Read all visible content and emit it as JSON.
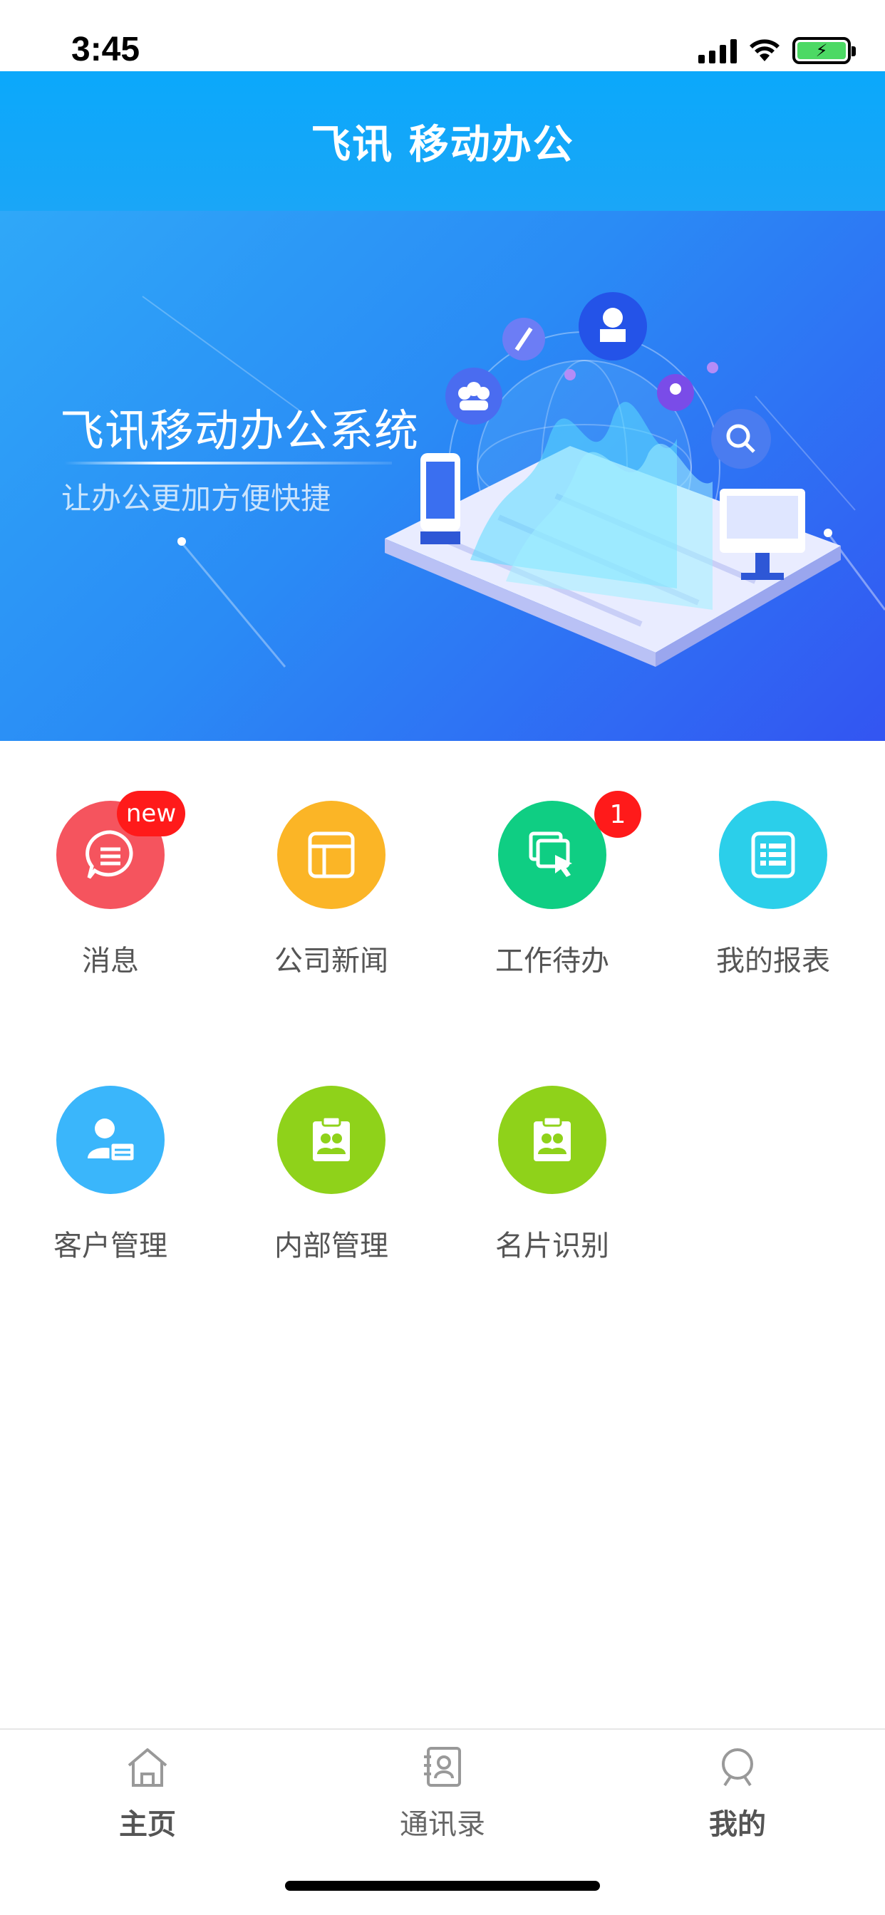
{
  "status_bar": {
    "time": "3:45",
    "battery_icon": "battery-charging-icon"
  },
  "header": {
    "title": "飞讯 移动办公"
  },
  "banner": {
    "title": "飞讯移动办公系统",
    "subtitle": "让办公更加方便快捷"
  },
  "grid": {
    "items": [
      {
        "label": "消息",
        "icon": "message-icon",
        "color": "#f5545e",
        "badge": "new"
      },
      {
        "label": "公司新闻",
        "icon": "news-layout-icon",
        "color": "#fbb526"
      },
      {
        "label": "工作待办",
        "icon": "task-cursor-icon",
        "color": "#0fce83",
        "badge": "1"
      },
      {
        "label": "我的报表",
        "icon": "report-list-icon",
        "color": "#2bcfea"
      },
      {
        "label": "客户管理",
        "icon": "customer-card-icon",
        "color": "#3ab6fb"
      },
      {
        "label": "内部管理",
        "icon": "contacts-clipboard-icon",
        "color": "#8fd21a"
      },
      {
        "label": "名片识别",
        "icon": "card-scan-clipboard-icon",
        "color": "#8fd21a"
      }
    ]
  },
  "tabs": [
    {
      "label": "主页",
      "icon": "home-icon",
      "active": true
    },
    {
      "label": "通讯录",
      "icon": "contacts-book-icon",
      "active": false
    },
    {
      "label": "我的",
      "icon": "profile-icon",
      "active": true
    }
  ]
}
